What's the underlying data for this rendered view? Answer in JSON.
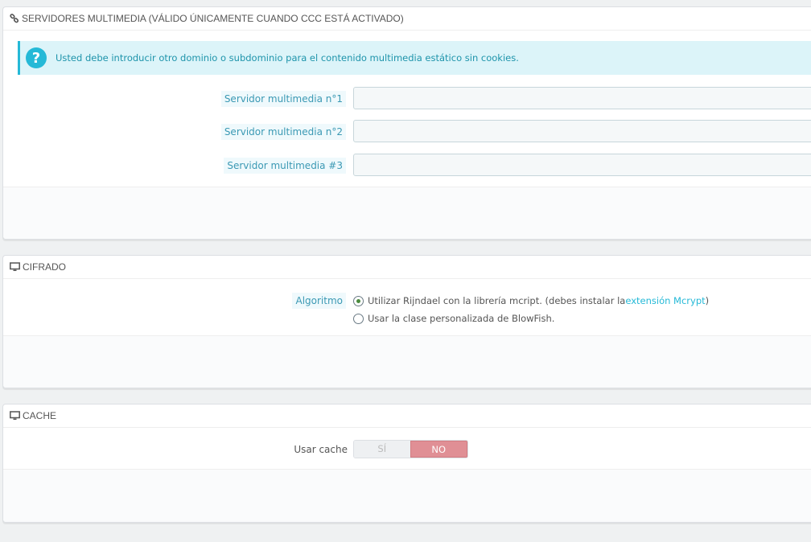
{
  "media_servers": {
    "heading": "SERVIDORES MULTIMEDIA (VÁLIDO ÚNICAMENTE CUANDO CCC ESTÁ ACTIVADO)",
    "heading_icon": "link-icon",
    "alert_icon": "question-circle-icon",
    "alert_text": "Usted debe introducir otro dominio o subdominio para el contenido multimedia estático sin cookies.",
    "fields": [
      {
        "label": "Servidor multimedia n°1",
        "value": ""
      },
      {
        "label": "Servidor multimedia n°2",
        "value": ""
      },
      {
        "label": "Servidor multimedia #3",
        "value": ""
      }
    ]
  },
  "encryption": {
    "heading": "CIFRADO",
    "heading_icon": "desktop-icon",
    "label": "Algoritmo",
    "options": [
      {
        "text": "Utilizar Rijndael con la librería mcript. (debes instalar la ",
        "link": "extensión Mcrypt",
        "suffix": ")",
        "selected": true
      },
      {
        "text": "Usar la clase personalizada de BlowFish.",
        "selected": false
      }
    ]
  },
  "cache": {
    "heading": "CACHE",
    "heading_icon": "desktop-icon",
    "label": "Usar cache",
    "yes_label": "SÍ",
    "no_label": "NO",
    "selected": "NO"
  },
  "colors": {
    "accent": "#25b9d7",
    "alert_bg": "#dcf4f9",
    "no_active": "#e08f95"
  }
}
